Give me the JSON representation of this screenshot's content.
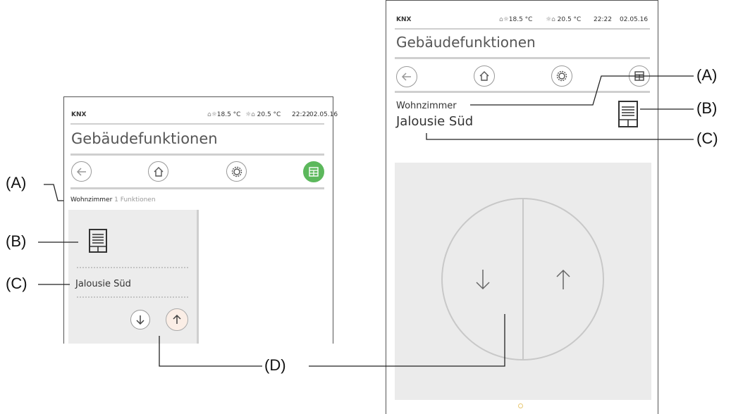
{
  "left_screen": {
    "status_bar": {
      "brand": "KNX",
      "indoor_temp": "18.5 °C",
      "outdoor_temp": "20.5 °C",
      "time": "22:22",
      "date": "02.05.16"
    },
    "title": "Gebäudefunktionen",
    "nav_icons": [
      "back-arrow-icon",
      "home-icon",
      "settings-gear-icon",
      "grid-view-icon"
    ],
    "room": "Wohnzimmer",
    "functions_count": "1 Funktionen",
    "tile": {
      "icon": "blind-icon",
      "label": "Jalousie Süd",
      "buttons": [
        "down-arrow-icon",
        "up-arrow-icon"
      ]
    }
  },
  "right_screen": {
    "status_bar": {
      "brand": "KNX",
      "indoor_temp": "18.5 °C",
      "outdoor_temp": "20.5 °C",
      "time": "22:22",
      "date": "02.05.16"
    },
    "title": "Gebäudefunktionen",
    "nav_icons": [
      "back-arrow-icon",
      "home-icon",
      "settings-gear-icon",
      "grid-view-icon"
    ],
    "room": "Wohnzimmer",
    "device": "Jalousie Süd",
    "device_icon": "blind-icon",
    "control_buttons": [
      "down-arrow-icon",
      "up-arrow-icon"
    ]
  },
  "callouts": {
    "a": "(A)",
    "b": "(B)",
    "c": "(C)",
    "d": "(D)"
  },
  "colors": {
    "accent_green": "#5cb85c",
    "tile_bg": "#ececec",
    "control_bg": "#ebebeb",
    "rule": "#cfcfcf"
  }
}
